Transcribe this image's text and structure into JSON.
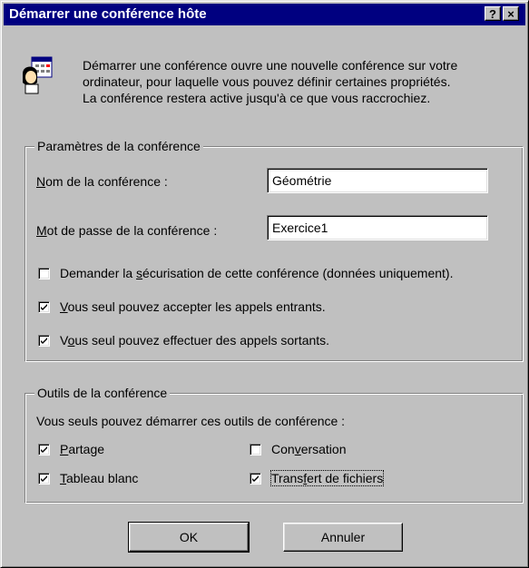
{
  "dialog": {
    "title": "Démarrer une conférence hôte",
    "help_label": "?",
    "close_label": "×"
  },
  "intro": {
    "icon": "conference-host-icon",
    "text": "Démarrer une conférence ouvre une nouvelle conférence sur votre\nordinateur, pour laquelle vous pouvez définir certaines propriétés.\nLa conférence restera active jusqu'à ce que vous raccrochiez."
  },
  "settings": {
    "legend": "Paramètres de la conférence",
    "name_label_mnemonic": "N",
    "name_label_rest": "om de la conférence :",
    "name_value": "Géométrie",
    "password_label_mnemonic": "M",
    "password_label_rest": "ot de passe de la conférence :",
    "password_value": "Exercice1",
    "secure": {
      "pre": "Demander la ",
      "mnemonic": "s",
      "post": "écurisation de cette conférence (données uniquement).",
      "checked": false
    },
    "incoming": {
      "pre": "",
      "mnemonic": "V",
      "post": "ous seul pouvez accepter les appels entrants.",
      "checked": true
    },
    "outgoing": {
      "pre": "V",
      "mnemonic": "o",
      "post": "us seul pouvez effectuer des appels sortants.",
      "checked": true
    }
  },
  "tools": {
    "legend": "Outils de la conférence",
    "description": "Vous seuls pouvez démarrer ces outils de conférence :",
    "sharing": {
      "pre": "",
      "mnemonic": "P",
      "post": "artage",
      "checked": true
    },
    "chat": {
      "pre": "Con",
      "mnemonic": "v",
      "post": "ersation",
      "checked": false
    },
    "whiteboard": {
      "pre": "",
      "mnemonic": "T",
      "post": "ableau blanc",
      "checked": true
    },
    "file_transfer": {
      "pre": "Trans",
      "mnemonic": "f",
      "post": "ert de fichiers",
      "checked": true
    }
  },
  "buttons": {
    "ok": "OK",
    "cancel": "Annuler"
  }
}
